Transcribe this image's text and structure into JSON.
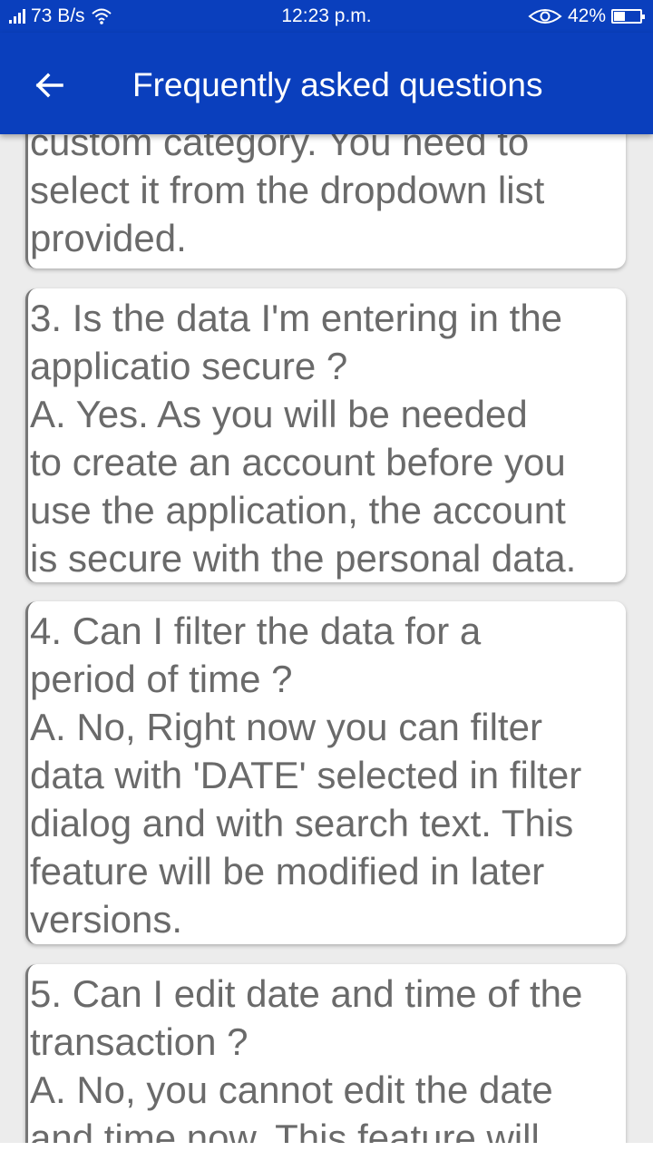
{
  "status_bar": {
    "data_rate": "73 B/s",
    "time": "12:23 p.m.",
    "battery_percent": "42%",
    "battery_level": 0.42,
    "icons": [
      "signal-icon",
      "wifi-icon",
      "eye-icon",
      "battery-icon"
    ]
  },
  "app_bar": {
    "title": "Frequently asked questions",
    "back_icon": "arrow-left-icon",
    "color": "#0a3fbd"
  },
  "faq": [
    {
      "text": "custom category. You need to\nselect it from the dropdown list\nprovided."
    },
    {
      "text": "3. Is the data I'm entering in the\napplicatio secure ?\n A. Yes. As you will be needed\nto create an account before you\nuse the application, the account\nis secure with the personal data."
    },
    {
      "text": "4. Can I filter the data for a\nperiod of time ?\n A. No, Right now you can filter\ndata with 'DATE' selected in filter\ndialog and with search text. This\nfeature will be modified in later\nversions."
    },
    {
      "text": "5. Can I edit date and time of the\ntransaction ?\n A. No, you cannot edit the date\nand time now. This feature will"
    }
  ]
}
